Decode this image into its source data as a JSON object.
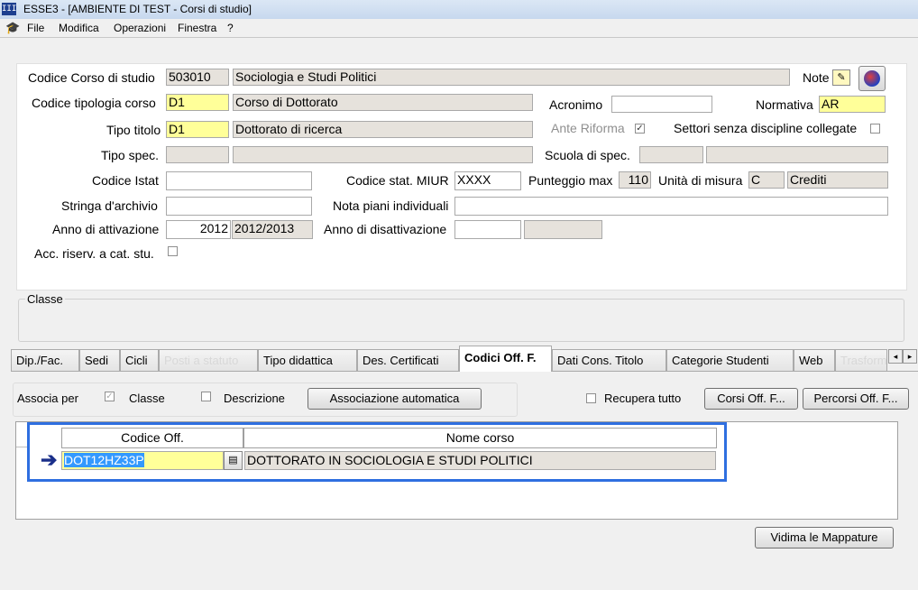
{
  "window": {
    "title": "ESSE3 - [AMBIENTE DI TEST - Corsi di studio]",
    "icon_text": "III"
  },
  "menu": {
    "items": [
      "File",
      "Modifica",
      "Operazioni",
      "Finestra",
      "?"
    ]
  },
  "form": {
    "codice_corso": {
      "label": "Codice Corso di studio",
      "code": "503010",
      "desc": "Sociologia e Studi Politici"
    },
    "note_label": "Note",
    "tipologia": {
      "label": "Codice tipologia corso",
      "code": "D1",
      "desc": "Corso di Dottorato"
    },
    "acronimo": {
      "label": "Acronimo",
      "value": ""
    },
    "normativa": {
      "label": "Normativa",
      "value": "AR"
    },
    "tipo_titolo": {
      "label": "Tipo titolo",
      "code": "D1",
      "desc": "Dottorato di ricerca"
    },
    "ante_riforma": {
      "label": "Ante Riforma",
      "checked": true
    },
    "settori": {
      "label": "Settori senza discipline collegate",
      "checked": false
    },
    "tipo_spec": {
      "label": "Tipo spec.",
      "code": "",
      "desc": ""
    },
    "scuola_spec": {
      "label": "Scuola di spec.",
      "code": "",
      "desc": ""
    },
    "codice_istat": {
      "label": "Codice Istat",
      "value": ""
    },
    "codice_miur": {
      "label": "Codice stat. MIUR",
      "value": "XXXX"
    },
    "punteggio": {
      "label": "Punteggio max",
      "value": "110"
    },
    "unita": {
      "label": "Unità di misura",
      "code": "C",
      "desc": "Crediti"
    },
    "stringa": {
      "label": "Stringa d'archivio",
      "value": ""
    },
    "nota_piani": {
      "label": "Nota piani individuali",
      "value": ""
    },
    "anno_attivazione": {
      "label": "Anno di attivazione",
      "value": "2012",
      "desc": "2012/2013"
    },
    "anno_disattivazione": {
      "label": "Anno di disattivazione",
      "value": "",
      "desc": ""
    },
    "acc_riserv": {
      "label": "Acc. riserv. a cat. stu.",
      "checked": false
    }
  },
  "classe": {
    "label": "Classe"
  },
  "tabs": [
    {
      "label": "Dip./Fac.",
      "state": "normal"
    },
    {
      "label": "Sedi",
      "state": "normal"
    },
    {
      "label": "Cicli",
      "state": "normal"
    },
    {
      "label": "Posti a statuto",
      "state": "disabled"
    },
    {
      "label": "Tipo didattica",
      "state": "normal"
    },
    {
      "label": "Des. Certificati",
      "state": "normal"
    },
    {
      "label": "Codici Off. F.",
      "state": "active"
    },
    {
      "label": "Dati Cons. Titolo",
      "state": "normal"
    },
    {
      "label": "Categorie Studenti",
      "state": "normal"
    },
    {
      "label": "Web",
      "state": "normal"
    },
    {
      "label": "Trasform",
      "state": "disabled"
    }
  ],
  "assoc": {
    "label": "Associa per",
    "classe": {
      "label": "Classe",
      "checked": true
    },
    "descrizione": {
      "label": "Descrizione",
      "checked": false
    },
    "auto_button": "Associazione automatica",
    "recupera": {
      "label": "Recupera tutto",
      "checked": false
    },
    "corsi_button": "Corsi Off. F...",
    "percorsi_button": "Percorsi Off. F..."
  },
  "grid": {
    "columns": [
      "Codice Off.",
      "Nome corso"
    ],
    "rows": [
      {
        "codice": "DOT12HZ33P",
        "nome": "DOTTORATO IN SOCIOLOGIA E STUDI POLITICI"
      }
    ]
  },
  "vidima_button": "Vidima le Mappature",
  "colors": {
    "highlight": "#2f6fe0",
    "yellow_field": "#ffff99",
    "gray_field": "#e6e2dc",
    "selection": "#3399ff"
  }
}
